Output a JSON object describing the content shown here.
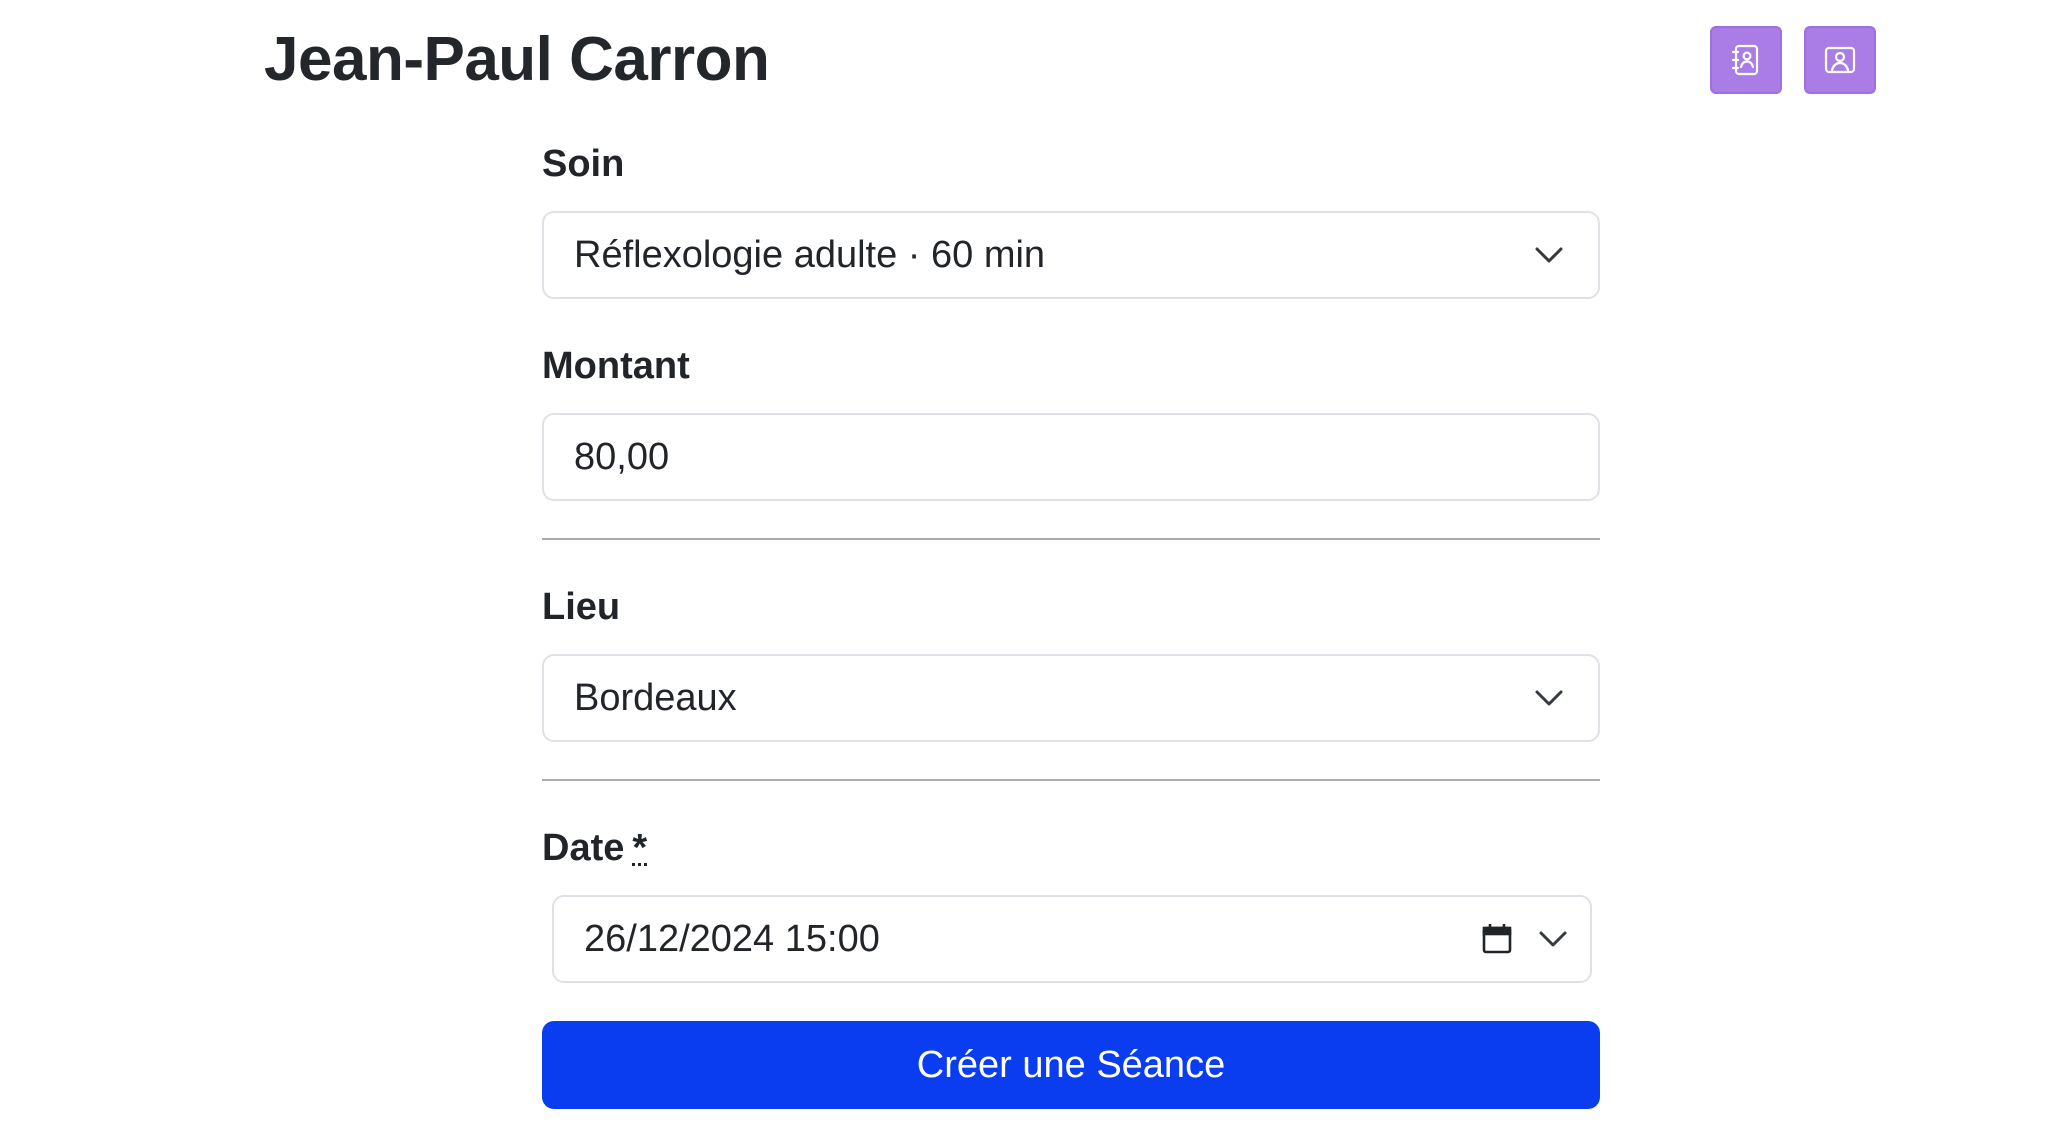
{
  "header": {
    "title": "Jean-Paul Carron",
    "icons": [
      "contacts-book-icon",
      "person-card-icon"
    ]
  },
  "form": {
    "soin": {
      "label": "Soin",
      "value": "Réflexologie adulte · 60 min",
      "icon": "chevron-down-icon"
    },
    "montant": {
      "label": "Montant",
      "value": "80,00"
    },
    "lieu": {
      "label": "Lieu",
      "value": "Bordeaux",
      "icon": "chevron-down-icon"
    },
    "date": {
      "label": "Date",
      "required_marker": "*",
      "value": "26/12/2024 15:00",
      "icons": [
        "calendar-icon",
        "chevron-down-icon"
      ]
    },
    "submit_label": "Créer une Séance"
  },
  "colors": {
    "icon_button_bg": "#a97ce6",
    "primary_button_bg": "#0a3cf0",
    "field_border": "#dee2e6",
    "divider": "#a7aab0",
    "text": "#212529"
  }
}
